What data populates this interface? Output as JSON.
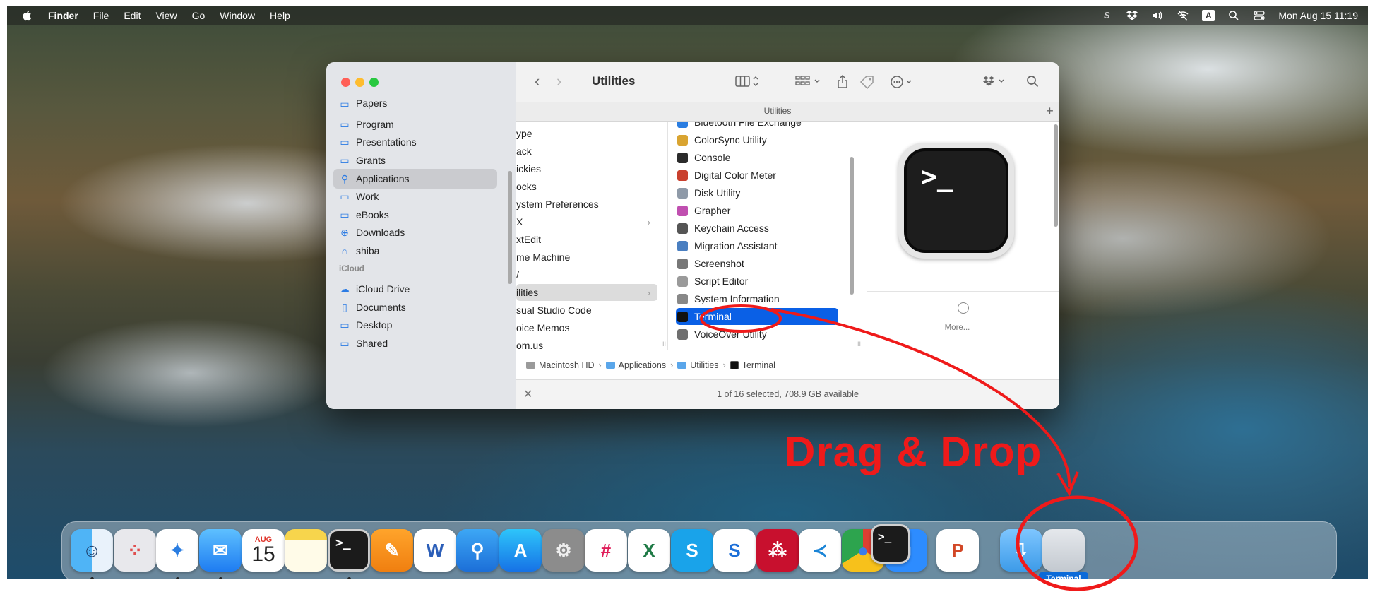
{
  "menubar": {
    "app_name": "Finder",
    "menus": [
      "File",
      "Edit",
      "View",
      "Go",
      "Window",
      "Help"
    ],
    "clock": "Mon Aug 15  11:19",
    "status_icons": [
      "scripting-icon",
      "dropbox-icon",
      "volume-icon",
      "wifi-off-icon",
      "input-source-icon",
      "spotlight-icon",
      "control-center-icon"
    ],
    "input_source": "A"
  },
  "finder": {
    "title": "Utilities",
    "path_label": "Utilities",
    "sidebar": {
      "items": [
        {
          "label": "Papers",
          "icon": "folder-icon"
        },
        {
          "label": "Program",
          "icon": "folder-icon"
        },
        {
          "label": "Presentations",
          "icon": "folder-icon"
        },
        {
          "label": "Grants",
          "icon": "folder-icon"
        },
        {
          "label": "Applications",
          "icon": "applications-icon",
          "selected": true
        },
        {
          "label": "Work",
          "icon": "folder-icon"
        },
        {
          "label": "eBooks",
          "icon": "folder-icon"
        },
        {
          "label": "Downloads",
          "icon": "downloads-icon"
        },
        {
          "label": "shiba",
          "icon": "home-icon"
        }
      ],
      "icloud_section": "iCloud",
      "icloud_items": [
        {
          "label": "iCloud Drive",
          "icon": "cloud-icon"
        },
        {
          "label": "Documents",
          "icon": "document-icon"
        },
        {
          "label": "Desktop",
          "icon": "desktop-icon"
        },
        {
          "label": "Shared",
          "icon": "shared-folder-icon"
        }
      ]
    },
    "column1": [
      {
        "label": "ype"
      },
      {
        "label": "ack"
      },
      {
        "label": "ickies"
      },
      {
        "label": "ocks"
      },
      {
        "label": "ystem Preferences"
      },
      {
        "label": "X",
        "has_children": true
      },
      {
        "label": "xtEdit"
      },
      {
        "label": "me Machine"
      },
      {
        "label": "/"
      },
      {
        "label": "ilities",
        "has_children": true,
        "selected": true
      },
      {
        "label": "sual Studio Code"
      },
      {
        "label": "oice Memos"
      },
      {
        "label": "om.us"
      }
    ],
    "column2": [
      {
        "label": "Bluetooth File Exchange",
        "color": "#2a7de1"
      },
      {
        "label": "ColorSync Utility",
        "color": "#d9a431"
      },
      {
        "label": "Console",
        "color": "#2b2b2b"
      },
      {
        "label": "Digital Color Meter",
        "color": "#c9402e"
      },
      {
        "label": "Disk Utility",
        "color": "#8f9aa8"
      },
      {
        "label": "Grapher",
        "color": "#c04fb0"
      },
      {
        "label": "Keychain Access",
        "color": "#555555"
      },
      {
        "label": "Migration Assistant",
        "color": "#4a7fc1"
      },
      {
        "label": "Screenshot",
        "color": "#777777"
      },
      {
        "label": "Script Editor",
        "color": "#9a9a9a"
      },
      {
        "label": "System Information",
        "color": "#888888"
      },
      {
        "label": "Terminal",
        "color": "#111111",
        "selected": true
      },
      {
        "label": "VoiceOver Utility",
        "color": "#6f6f6f"
      }
    ],
    "preview": {
      "prompt": ">_",
      "more_label": "More..."
    },
    "pathbar": [
      "Macintosh HD",
      "Applications",
      "Utilities",
      "Terminal"
    ],
    "status": "1 of 16 selected, 708.9 GB available"
  },
  "annotation": {
    "text": "Drag & Drop",
    "color": "#ef1a1a"
  },
  "dock": {
    "tooltip": "Terminal",
    "calendar": {
      "month": "AUG",
      "day": "15"
    },
    "apps": [
      {
        "name": "finder-icon",
        "running": true
      },
      {
        "name": "launchpad-icon",
        "running": false
      },
      {
        "name": "safari-icon",
        "running": true
      },
      {
        "name": "mail-icon",
        "running": true
      },
      {
        "name": "calendar-icon",
        "running": false
      },
      {
        "name": "notes-icon",
        "running": false
      },
      {
        "name": "terminal-icon",
        "running": true
      },
      {
        "name": "pages-icon",
        "running": false
      },
      {
        "name": "word-icon",
        "running": false
      },
      {
        "name": "keynote-icon",
        "running": false
      },
      {
        "name": "app-store-icon",
        "running": false
      },
      {
        "name": "system-preferences-icon",
        "running": false
      },
      {
        "name": "slack-icon",
        "running": false
      },
      {
        "name": "excel-icon",
        "running": false
      },
      {
        "name": "skype-icon",
        "running": false
      },
      {
        "name": "scrivener-icon",
        "running": false
      },
      {
        "name": "mendeley-icon",
        "running": false
      },
      {
        "name": "vscode-icon",
        "running": false
      },
      {
        "name": "chrome-icon",
        "running": false
      },
      {
        "name": "zoom-icon",
        "running": false
      },
      {
        "name": "powerpoint-icon",
        "running": false
      },
      {
        "name": "downloads-folder-icon",
        "running": false
      },
      {
        "name": "trash-icon",
        "running": false
      }
    ]
  }
}
